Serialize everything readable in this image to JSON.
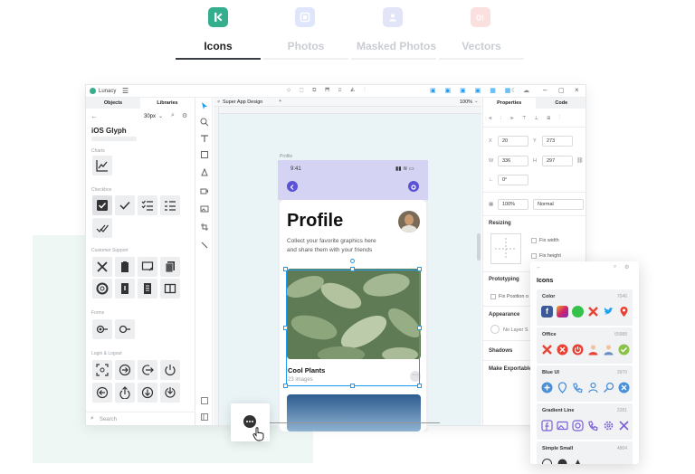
{
  "top_tabs": [
    {
      "label": "Icons",
      "active": true,
      "icon": "brand-k-icon",
      "color": "#35ae8e"
    },
    {
      "label": "Photos",
      "active": false,
      "icon": "photo-icon",
      "color": "#c4cdf5"
    },
    {
      "label": "Masked Photos",
      "active": false,
      "icon": "masked-photo-icon",
      "color": "#cfd3f2"
    },
    {
      "label": "Vectors",
      "active": false,
      "icon": "vector-icon",
      "color": "#f7c9c9"
    }
  ],
  "app": {
    "name": "Lunacy",
    "doc_tab": "Super App Design",
    "zoom": "100%",
    "left_panel": {
      "tabs": [
        "Objects",
        "Libraries"
      ],
      "size": "30px",
      "library_title": "iOS Glyph",
      "sections": [
        "Charts",
        "Checkbox",
        "Customer Support",
        "Forms",
        "Login & Logout"
      ],
      "search_placeholder": "Search"
    },
    "artboard_label": "Profile",
    "right_panel": {
      "tabs": [
        "Properties",
        "Code"
      ],
      "x": "20",
      "y": "273",
      "w": "336",
      "h": "297",
      "rotation": "0°",
      "opacity": "100%",
      "blend": "Normal",
      "resizing": "Resizing",
      "fix_width": "Fix width",
      "fix_height": "Fix height",
      "prototyping": "Prototyping",
      "fix_position": "Fix Position o",
      "appearance": "Appearance",
      "no_layer": "No Layer S",
      "shadows": "Shadows",
      "make_exportable": "Make Exportable"
    }
  },
  "phone": {
    "time": "9:41",
    "title": "Profile",
    "subtitle_1": "Collect your favorite graphics here",
    "subtitle_2": "and share them with your friends",
    "card_title": "Cool Plants",
    "card_sub": "23 images"
  },
  "icons_panel": {
    "title": "Icons",
    "groups": [
      {
        "name": "Color",
        "count": "7046"
      },
      {
        "name": "Office",
        "count": "65988"
      },
      {
        "name": "Blue UI",
        "count": "3970"
      },
      {
        "name": "Gradient Line",
        "count": "2281"
      },
      {
        "name": "Simple Small",
        "count": "4804"
      }
    ]
  },
  "colors": {
    "accent": "#1b9cf2",
    "brand": "#35ae8e",
    "phone_header": "#d4d3f3",
    "purple": "#5b52d6"
  }
}
